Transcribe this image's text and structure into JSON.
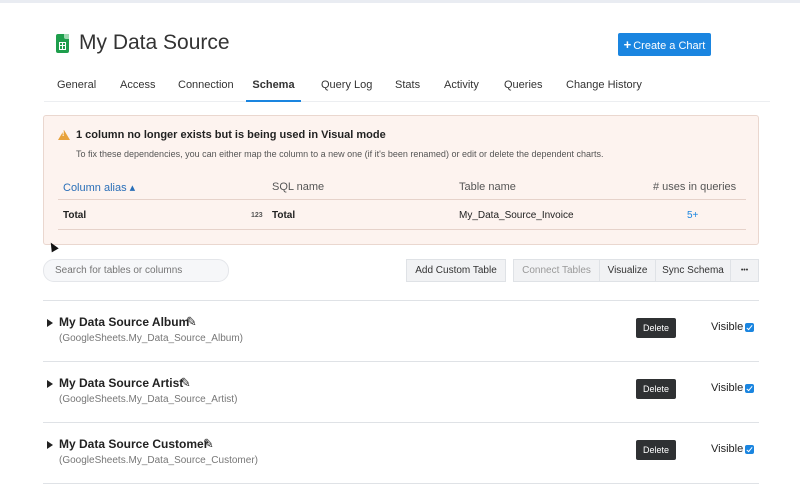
{
  "header": {
    "title": "My Data Source",
    "create_chart_label": "Create a Chart"
  },
  "tabs": [
    {
      "label": "General"
    },
    {
      "label": "Access"
    },
    {
      "label": "Connection"
    },
    {
      "label": "Schema",
      "active": true
    },
    {
      "label": "Query Log"
    },
    {
      "label": "Stats"
    },
    {
      "label": "Activity"
    },
    {
      "label": "Queries"
    },
    {
      "label": "Change History"
    }
  ],
  "warning": {
    "title": "1 column no longer exists but is being used in Visual mode",
    "subtitle": "To fix these dependencies, you can either map the column to a new one (if it's been renamed) or edit or delete the dependent charts.",
    "columns": [
      "Column alias",
      "SQL name",
      "Table name",
      "# uses in queries"
    ],
    "row": {
      "alias": "Total",
      "type": "123",
      "sql_name": "Total",
      "table_name": "My_Data_Source_Invoice",
      "uses": "5+"
    }
  },
  "toolbar": {
    "search_placeholder": "Search for tables or columns",
    "add_custom_table": "Add Custom Table",
    "connect_tables": "Connect Tables",
    "visualize": "Visualize",
    "sync_schema": "Sync Schema",
    "more": "•••"
  },
  "tables": [
    {
      "name": "My Data Source Album",
      "sub": "(GoogleSheets.My_Data_Source_Album)",
      "delete": "Delete",
      "visible_label": "Visible",
      "visible": true
    },
    {
      "name": "My Data Source Artist",
      "sub": "(GoogleSheets.My_Data_Source_Artist)",
      "delete": "Delete",
      "visible_label": "Visible",
      "visible": true
    },
    {
      "name": "My Data Source Customer",
      "sub": "(GoogleSheets.My_Data_Source_Customer)",
      "delete": "Delete",
      "visible_label": "Visible",
      "visible": true
    }
  ],
  "colors": {
    "accent": "#1a85e0",
    "warning_bg": "#fdf3ef",
    "warning_icon": "#e8a23a",
    "sheets_green": "#1e9e4c"
  },
  "icons": {
    "logo": "google-sheets-icon",
    "warning": "warning-icon",
    "edit": "pencil-icon",
    "expand": "triangle-right-icon"
  }
}
